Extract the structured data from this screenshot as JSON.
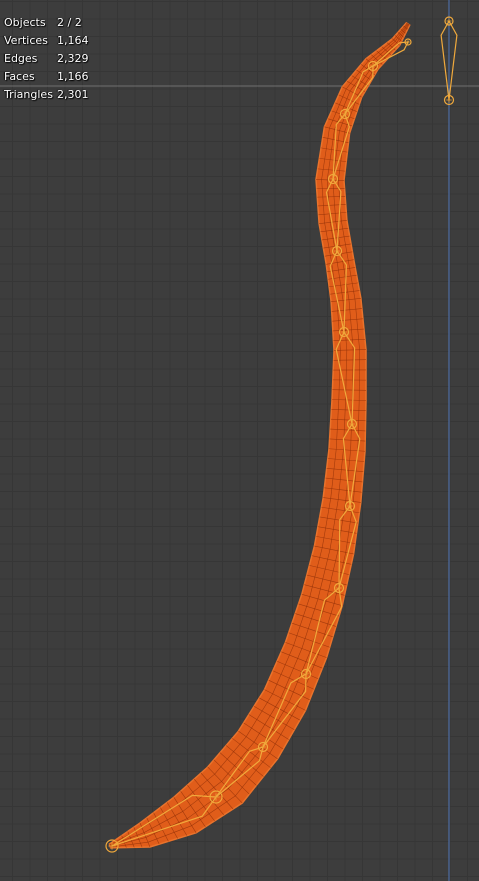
{
  "stats": [
    {
      "label": "Objects",
      "value": "2 / 2"
    },
    {
      "label": "Vertices",
      "value": "1,164"
    },
    {
      "label": "Edges",
      "value": "2,329"
    },
    {
      "label": "Faces",
      "value": "1,166"
    },
    {
      "label": "Triangles",
      "value": "2,301"
    }
  ],
  "colors": {
    "background": "#3d3d3d",
    "grid_minor": "#363636",
    "grid_major": "#4a4a4a",
    "mesh_fill": "#e05d1a",
    "mesh_wire": "#8f2f07",
    "bone": "#f0a93c",
    "axis_y": "#5177b8",
    "axis_x": "#9a9a9a"
  }
}
